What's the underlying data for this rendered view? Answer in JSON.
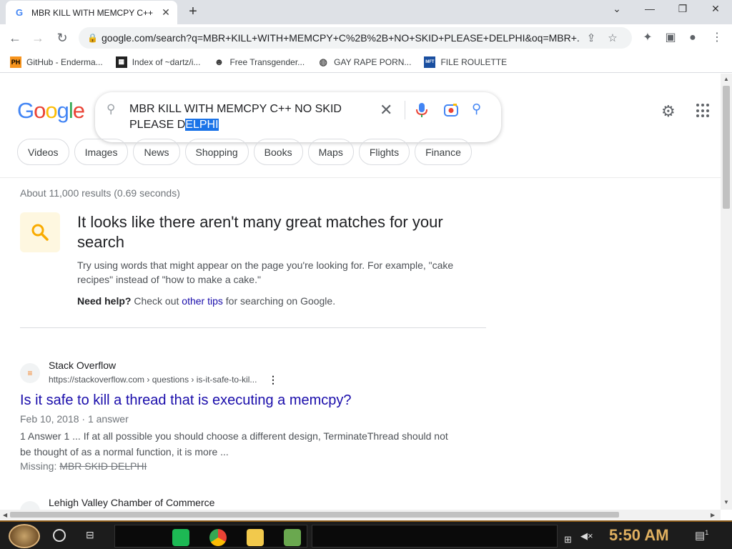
{
  "browser": {
    "tab_title": "MBR KILL WITH MEMCPY C++",
    "tab_favicon": "G",
    "url": "google.com/search?q=MBR+KILL+WITH+MEMCPY+C%2B%2B+NO+SKID+PLEASE+DELPHI&oq=MBR+...",
    "bookmarks": [
      {
        "label": "GitHub - Enderma...",
        "icon": "PH"
      },
      {
        "label": "Index of ~dartz/i...",
        "icon": "folder-icon"
      },
      {
        "label": "Free Transgender...",
        "icon": "mask-icon"
      },
      {
        "label": "GAY RAPE PORN...",
        "icon": "globe-icon"
      },
      {
        "label": "FILE ROULETTE",
        "icon": "MFT"
      }
    ]
  },
  "search": {
    "query_part1": "MBR KILL WITH MEMCPY C++ NO SKID",
    "query_part2_prefix": "PLEASE D",
    "query_part2_selected": "ELPHI"
  },
  "chips": [
    "Videos",
    "Images",
    "News",
    "Shopping",
    "Books",
    "Maps",
    "Flights",
    "Finance"
  ],
  "results": {
    "stats": "About 11,000 results (0.69 seconds)",
    "tip_title": "It looks like there aren't many great matches for your search",
    "tip_body": "Try using words that might appear on the page you're looking for. For example, \"cake recipes\" instead of \"how to make a cake.\"",
    "tip_help_bold": "Need help?",
    "tip_help_pre": " Check out ",
    "tip_help_link": "other tips",
    "tip_help_post": " for searching on Google.",
    "items": [
      {
        "site": "Stack Overflow",
        "url": "https://stackoverflow.com › questions › is-it-safe-to-kil...",
        "title": "Is it safe to kill a thread that is executing a memcpy?",
        "date": "Feb 10, 2018 · 1 answer",
        "snippet": "1 Answer 1 ... If at all possible you should choose a different design, TerminateThread should not be thought of as a normal function, it is more ...",
        "missing_label": "Missing:",
        "missing_terms": "MBR SKID DELPHI"
      },
      {
        "site": "Lehigh Valley Chamber of Commerce"
      }
    ]
  },
  "taskbar": {
    "time": "5:50 AM",
    "notifications": "1"
  },
  "colors": {
    "link": "#1a0dab",
    "selection": "#1a73e8",
    "tip_bg": "#fef7e0",
    "tip_icon": "#f9ab00"
  }
}
